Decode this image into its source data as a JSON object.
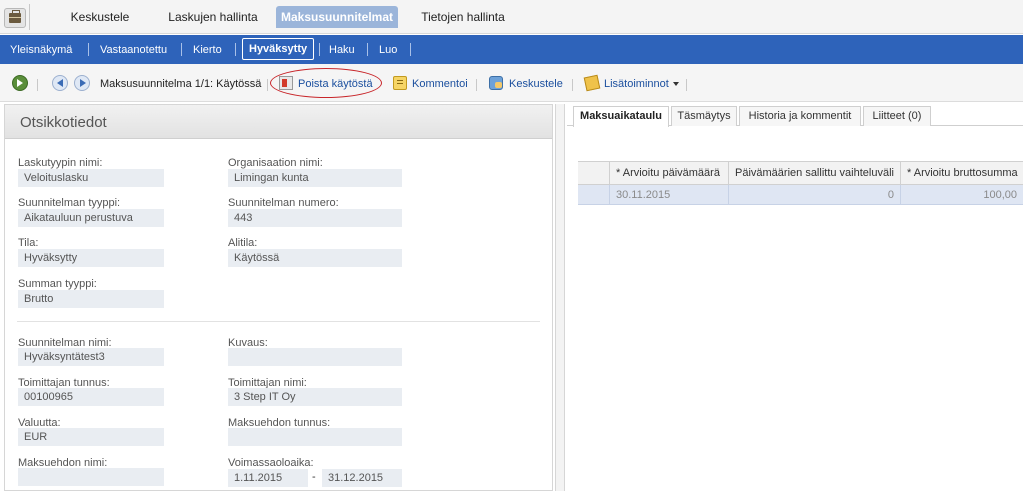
{
  "top_tabs": [
    "Keskustele",
    "Laskujen hallinta",
    "Maksusuunnitelmat",
    "Tietojen hallinta"
  ],
  "subnav": [
    "Yleisnäkymä",
    "Vastaanotettu",
    "Kierto",
    "Hyväksytty",
    "Haku",
    "Luo"
  ],
  "toolbar": {
    "record_label": "Maksusuunnitelma 1/1: Käytössä",
    "remove_label": "Poista käytöstä",
    "comment_label": "Kommentoi",
    "discuss_label": "Keskustele",
    "more_label": "Lisätoiminnot"
  },
  "header": {
    "title": "Otsikkotiedot"
  },
  "fields": {
    "invoice_type_name": {
      "label": "Laskutyypin nimi:",
      "value": "Veloituslasku"
    },
    "organisation_name": {
      "label": "Organisaation nimi:",
      "value": "Limingan kunta"
    },
    "plan_type": {
      "label": "Suunnitelman tyyppi:",
      "value": "Aikatauluun perustuva"
    },
    "plan_number": {
      "label": "Suunnitelman numero:",
      "value": "443"
    },
    "state": {
      "label": "Tila:",
      "value": "Hyväksytty"
    },
    "substate": {
      "label": "Alitila:",
      "value": "Käytössä"
    },
    "sum_type": {
      "label": "Summan tyyppi:",
      "value": "Brutto"
    },
    "plan_name": {
      "label": "Suunnitelman nimi:",
      "value": "Hyväksyntätest3"
    },
    "description": {
      "label": "Kuvaus:",
      "value": ""
    },
    "supplier_id": {
      "label": "Toimittajan tunnus:",
      "value": "00100965"
    },
    "supplier_name": {
      "label": "Toimittajan nimi:",
      "value": "3 Step IT Oy"
    },
    "currency": {
      "label": "Valuutta:",
      "value": "EUR"
    },
    "payment_term_id": {
      "label": "Maksuehdon tunnus:",
      "value": ""
    },
    "payment_term_name": {
      "label": "Maksuehdon nimi:",
      "value": ""
    },
    "validity": {
      "label": "Voimassaoloaika:",
      "start": "1.11.2015",
      "separator": "-",
      "end": "31.12.2015"
    }
  },
  "right_tabs": [
    "Maksuaikataulu",
    "Täsmäytys",
    "Historia ja kommentit",
    "Liitteet (0)"
  ],
  "schedule": {
    "columns": [
      "* Arvioitu päivämäärä",
      "Päivämäärien sallittu vaihteluväli",
      "* Arvioitu bruttosumma"
    ],
    "rows": [
      [
        "30.11.2015",
        "0",
        "100,00"
      ]
    ]
  }
}
